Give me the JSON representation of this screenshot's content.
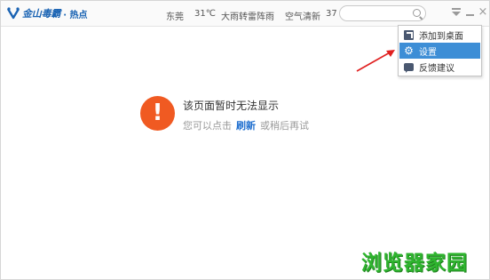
{
  "app": {
    "logo_text": "金山毒霸",
    "section": "· 热点"
  },
  "weather": {
    "city": "东莞",
    "temperature": "31℃",
    "condition": "大雨转雷阵雨",
    "air_quality_label": "空气清新",
    "air_quality_value": "37"
  },
  "search": {
    "value": "",
    "placeholder": ""
  },
  "dropdown": {
    "items": [
      {
        "label": "添加到桌面",
        "icon": "desktop-shortcut-icon"
      },
      {
        "label": "设置",
        "icon": "gear-icon"
      },
      {
        "label": "反馈建议",
        "icon": "feedback-icon"
      }
    ],
    "highlight_color": "#3d8ed6"
  },
  "error": {
    "title": "该页面暂时无法显示",
    "hint_before": "您可以点击",
    "refresh_label": "刷新",
    "hint_after": "或稍后再试",
    "icon_color": "#f05a22"
  },
  "watermark": {
    "text": "浏览器家园"
  },
  "colors": {
    "brand": "#1a63b3",
    "link": "#1f6fcf",
    "annotation_arrow": "#e02020"
  }
}
